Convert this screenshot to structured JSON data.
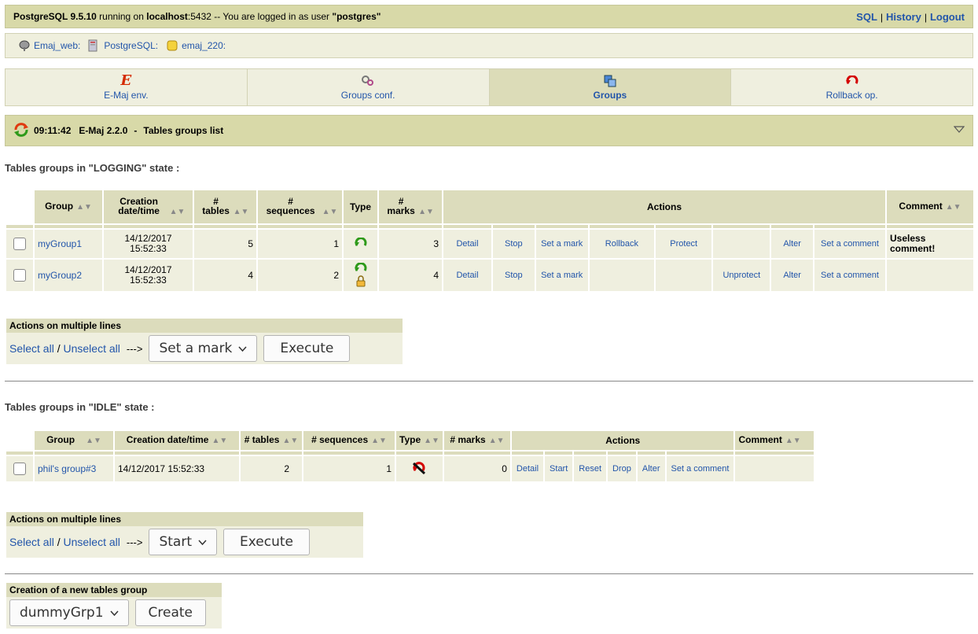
{
  "topbar": {
    "product": "PostgreSQL 9.5.10",
    "running_on": "running on",
    "host": "localhost",
    "port_and_user_text": ":5432 -- You are logged in as user",
    "user": "\"postgres\"",
    "links": {
      "sql": "SQL",
      "history": "History",
      "logout": "Logout"
    }
  },
  "breadcrumb": {
    "items": [
      "Emaj_web:",
      "PostgreSQL:",
      "emaj_220:"
    ]
  },
  "tabs": [
    {
      "label": "E-Maj env.",
      "icon": "emaj-logo-icon"
    },
    {
      "label": "Groups conf.",
      "icon": "gears-icon"
    },
    {
      "label": "Groups",
      "icon": "groups-icon",
      "active": true
    },
    {
      "label": "Rollback op.",
      "icon": "rollback-arrow-icon"
    }
  ],
  "section": {
    "time": "09:11:42",
    "version": "E-Maj 2.2.0",
    "separator": "-",
    "title": "Tables groups list"
  },
  "logging": {
    "subtitle": "Tables groups in \"LOGGING\" state :",
    "headers": {
      "group": "Group",
      "creation": "Creation date/time",
      "tables": "# tables",
      "sequences": "# sequences",
      "type": "Type",
      "marks": "# marks",
      "actions": "Actions",
      "comment": "Comment"
    },
    "rows": [
      {
        "group": "myGroup1",
        "date": "14/12/2017",
        "time": "15:52:33",
        "tables": "5",
        "sequences": "1",
        "marks": "3",
        "a_detail": "Detail",
        "a_stop": "Stop",
        "a_mark": "Set a mark",
        "a_rollback": "Rollback",
        "a_protect": "Protect",
        "a_unprotect": "",
        "a_alter": "Alter",
        "a_comment": "Set a comment",
        "comment": "Useless comment!"
      },
      {
        "group": "myGroup2",
        "date": "14/12/2017",
        "time": "15:52:33",
        "tables": "4",
        "sequences": "2",
        "marks": "4",
        "a_detail": "Detail",
        "a_stop": "Stop",
        "a_mark": "Set a mark",
        "a_rollback": "",
        "a_protect": "",
        "a_unprotect": "Unprotect",
        "a_alter": "Alter",
        "a_comment": "Set a comment",
        "comment": ""
      }
    ],
    "multi": {
      "header": "Actions on multiple lines",
      "select_all": "Select all",
      "slash": "/",
      "unselect_all": "Unselect all",
      "arrow": "--->",
      "selected_action": "Set a mark",
      "execute": "Execute"
    }
  },
  "idle": {
    "subtitle": "Tables groups in \"IDLE\" state :",
    "headers": {
      "group": "Group",
      "creation": "Creation date/time",
      "tables": "# tables",
      "sequences": "# sequences",
      "type": "Type",
      "marks": "# marks",
      "actions": "Actions",
      "comment": "Comment"
    },
    "rows": [
      {
        "group": "phil's group#3",
        "datetime": "14/12/2017 15:52:33",
        "tables": "2",
        "sequences": "1",
        "marks": "0",
        "a_detail": "Detail",
        "a_start": "Start",
        "a_reset": "Reset",
        "a_drop": "Drop",
        "a_alter": "Alter",
        "a_comment": "Set a comment",
        "comment": ""
      }
    ],
    "multi": {
      "header": "Actions on multiple lines",
      "select_all": "Select all",
      "slash": "/",
      "unselect_all": "Unselect all",
      "arrow": "--->",
      "selected_action": "Start",
      "execute": "Execute"
    }
  },
  "create": {
    "header": "Creation of a new tables group",
    "selected_group": "dummyGrp1",
    "create_label": "Create"
  },
  "colors": {
    "bar": "#d8d9a8",
    "cell": "#efefdf",
    "header_cell": "#dcdcbc",
    "link": "#2255aa",
    "rollback_red": "#d40000",
    "logging_green": "#2e9a1a"
  }
}
